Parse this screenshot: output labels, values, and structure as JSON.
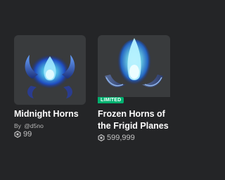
{
  "items": [
    {
      "name": "Midnight Horns",
      "creator_prefix": "By",
      "creator": "@d5no",
      "price": "99",
      "price_icon": "robux-icon"
    },
    {
      "badge": "LIMITED",
      "name_line1": "Frozen Horns of",
      "name_line2": "the Frigid Planes",
      "price": "599,999",
      "price_icon": "robux-icon"
    }
  ],
  "colors": {
    "background": "#242527",
    "thumbnail_bg": "#393b3d",
    "limited_badge": "#00b06f",
    "text_primary": "#ffffff",
    "text_secondary": "#b8b8b8"
  }
}
